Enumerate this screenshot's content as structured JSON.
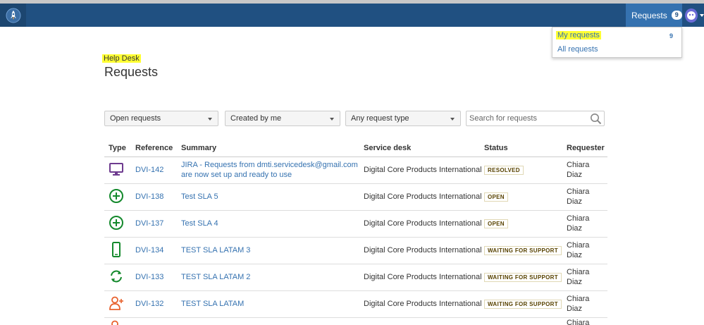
{
  "header": {
    "nav_requests_label": "Requests",
    "nav_requests_count": "9",
    "colors": {
      "bar": "#205081",
      "nav_active": "#3572b0"
    }
  },
  "dropdown": {
    "my_requests": "My requests",
    "my_requests_count": "9",
    "all_requests": "All requests"
  },
  "breadcrumb": "Help Desk",
  "page_title": "Requests",
  "filters": {
    "status": "Open requests",
    "creator": "Created by me",
    "type": "Any request type",
    "search_placeholder": "Search for requests"
  },
  "table": {
    "headers": [
      "Type",
      "Reference",
      "Summary",
      "Service desk",
      "Status",
      "Requester"
    ],
    "rows": [
      {
        "icon": "monitor-icon",
        "ref": "DVI-142",
        "summary_line1": "JIRA - Requests from dmti.servicedesk@gmail.com",
        "summary_line2": "are now set up and ready to use",
        "desk": "Digital Core Products International",
        "status": "RESOLVED",
        "req1": "Chiara",
        "req2": "Diaz"
      },
      {
        "icon": "plus-circle-icon",
        "ref": "DVI-138",
        "summary_line1": "Test SLA 5",
        "summary_line2": "",
        "desk": "Digital Core Products International",
        "status": "OPEN",
        "req1": "Chiara",
        "req2": "Diaz"
      },
      {
        "icon": "plus-circle-icon",
        "ref": "DVI-137",
        "summary_line1": "Test SLA 4",
        "summary_line2": "",
        "desk": "Digital Core Products International",
        "status": "OPEN",
        "req1": "Chiara",
        "req2": "Diaz"
      },
      {
        "icon": "mobile-icon",
        "ref": "DVI-134",
        "summary_line1": "TEST SLA LATAM 3",
        "summary_line2": "",
        "desk": "Digital Core Products International",
        "status": "WAITING FOR SUPPORT",
        "req1": "Chiara",
        "req2": "Diaz"
      },
      {
        "icon": "refresh-icon",
        "ref": "DVI-133",
        "summary_line1": "TEST SLA LATAM 2",
        "summary_line2": "",
        "desk": "Digital Core Products International",
        "status": "WAITING FOR SUPPORT",
        "req1": "Chiara",
        "req2": "Diaz"
      },
      {
        "icon": "add-user-icon",
        "ref": "DVI-132",
        "summary_line1": "TEST SLA LATAM",
        "summary_line2": "",
        "desk": "Digital Core Products International",
        "status": "WAITING FOR SUPPORT",
        "req1": "Chiara",
        "req2": "Diaz"
      }
    ],
    "partial_requester": "Chiara"
  }
}
